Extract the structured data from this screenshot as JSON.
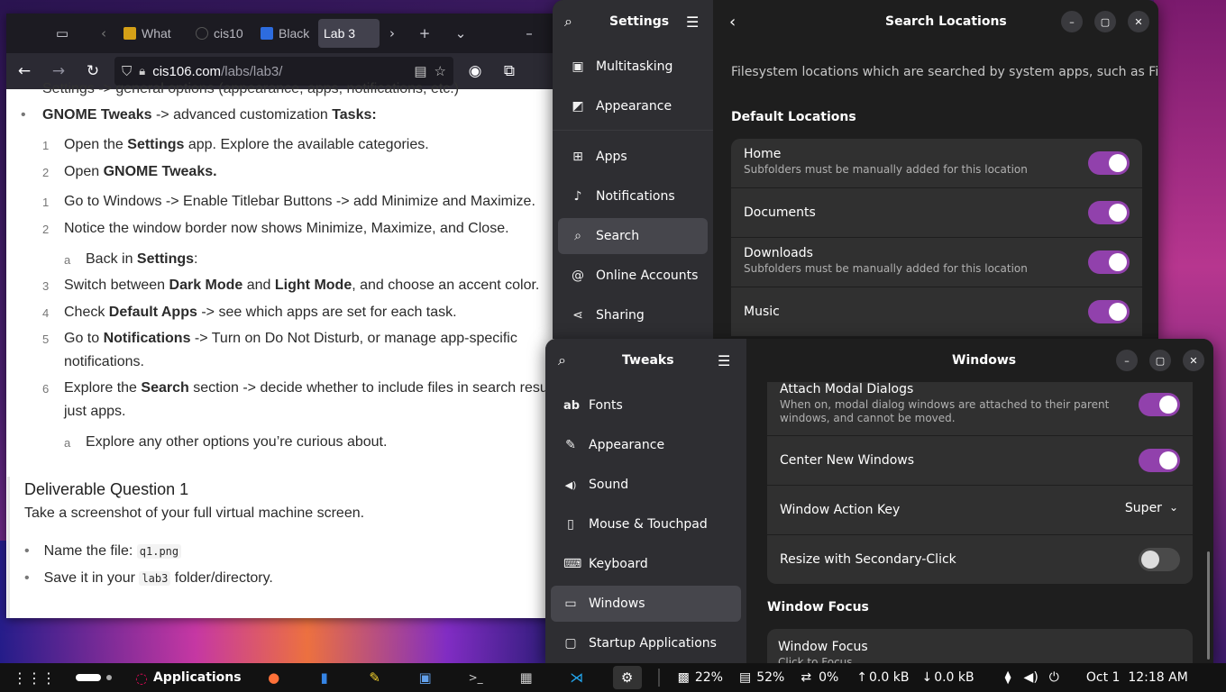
{
  "browser": {
    "tabs": [
      {
        "label": "What",
        "color": "#d4a017"
      },
      {
        "label": "cis10",
        "color": "#1c1b22"
      },
      {
        "label": "Black",
        "color": "#2d6cdf"
      },
      {
        "label": "Lab 3",
        "color": ""
      }
    ],
    "url_domain": "cis106.com",
    "url_path": "/labs/lab3/",
    "content": {
      "partial_top": "Settings -> general options (appearance, apps, notifications, etc.)",
      "bullet_tweaks_a": "GNOME Tweaks",
      "bullet_tweaks_b": " -> advanced customization ",
      "bullet_tweaks_c": "Tasks:",
      "items": [
        {
          "n": "1",
          "a": "Open the ",
          "b": "Settings",
          "c": " app. Explore the available categories."
        },
        {
          "n": "2",
          "a": "Open ",
          "b": "GNOME Tweaks.",
          "c": ""
        },
        {
          "n": "1",
          "a": "Go to Windows -> Enable Titlebar Buttons -> add Minimize and Maximize.",
          "b": "",
          "c": ""
        },
        {
          "n": "2",
          "a": "Notice the window border now shows Minimize, Maximize, and Close.",
          "b": "",
          "c": ""
        }
      ],
      "sub_a": {
        "n": "a",
        "a": "Back in ",
        "b": "Settings",
        "c": ":"
      },
      "items2": [
        {
          "n": "3",
          "a": "Switch between ",
          "b": "Dark Mode",
          "c": " and ",
          "d": "Light Mode",
          "e": ", and choose an accent color."
        },
        {
          "n": "4",
          "a": "Check ",
          "b": "Default Apps",
          "c": " -> see which apps are set for each task.",
          "d": "",
          "e": ""
        },
        {
          "n": "5",
          "a": "Go to ",
          "b": "Notifications",
          "c": " -> Turn on Do Not Disturb, or manage app-specific",
          "d": "",
          "e": ""
        },
        {
          "n": "6",
          "a": "Explore the ",
          "b": "Search",
          "c": " section -> decide whether to include files in search results or",
          "d": "",
          "e": ""
        }
      ],
      "item5_cont": "notifications.",
      "item6_cont": "just apps.",
      "sub_b": {
        "n": "a",
        "text": "Explore any other options you’re curious about."
      },
      "deliverable": {
        "title": "Deliverable Question 1",
        "text": "Take a screenshot of your full virtual machine screen.",
        "b1_a": "Name the file: ",
        "b1_code": "q1.png",
        "b2_a": "Save it in your ",
        "b2_code": "lab3",
        "b2_c": " folder/directory."
      }
    }
  },
  "settings": {
    "sidebar_title": "Settings",
    "items": [
      {
        "label": "Multitasking",
        "icon": "▣"
      },
      {
        "label": "Appearance",
        "icon": "◩"
      },
      {
        "label": "Apps",
        "icon": "⊞"
      },
      {
        "label": "Notifications",
        "icon": "🔔"
      },
      {
        "label": "Search",
        "icon": "⌕"
      },
      {
        "label": "Online Accounts",
        "icon": "@"
      },
      {
        "label": "Sharing",
        "icon": "⋖"
      }
    ],
    "page_title": "Search Locations",
    "description": "Filesystem locations which are searched by system apps, such as Files",
    "section": "Default Locations",
    "locations": [
      {
        "title": "Home",
        "sub": "Subfolders must be manually added for this location",
        "on": true
      },
      {
        "title": "Documents",
        "sub": "",
        "on": true
      },
      {
        "title": "Downloads",
        "sub": "Subfolders must be manually added for this location",
        "on": true
      },
      {
        "title": "Music",
        "sub": "",
        "on": true
      }
    ]
  },
  "tweaks": {
    "sidebar_title": "Tweaks",
    "page_title": "Windows",
    "items": [
      {
        "label": "Fonts",
        "icon": "ab"
      },
      {
        "label": "Appearance",
        "icon": "✎"
      },
      {
        "label": "Sound",
        "icon": "◀)"
      },
      {
        "label": "Mouse & Touchpad",
        "icon": "▯"
      },
      {
        "label": "Keyboard",
        "icon": "⌨"
      },
      {
        "label": "Windows",
        "icon": "▭"
      },
      {
        "label": "Startup Applications",
        "icon": "▢"
      }
    ],
    "rows": {
      "attach_title": "Attach Modal Dialogs",
      "attach_sub": "When on, modal dialog windows are attached to their parent windows, and cannot be moved.",
      "center_title": "Center New Windows",
      "action_key_title": "Window Action Key",
      "action_key_value": "Super",
      "resize_title": "Resize with Secondary-Click"
    },
    "focus_section": "Window Focus",
    "focus_row": "Window Focus",
    "focus_row_sub": "Click to Focus"
  },
  "taskbar": {
    "applications": "Applications",
    "cpu": "22%",
    "mem": "52%",
    "swap": "0%",
    "net_up": "0.0 kB",
    "net_down": "0.0 kB",
    "clock": "Oct 1  12:18 AM"
  }
}
